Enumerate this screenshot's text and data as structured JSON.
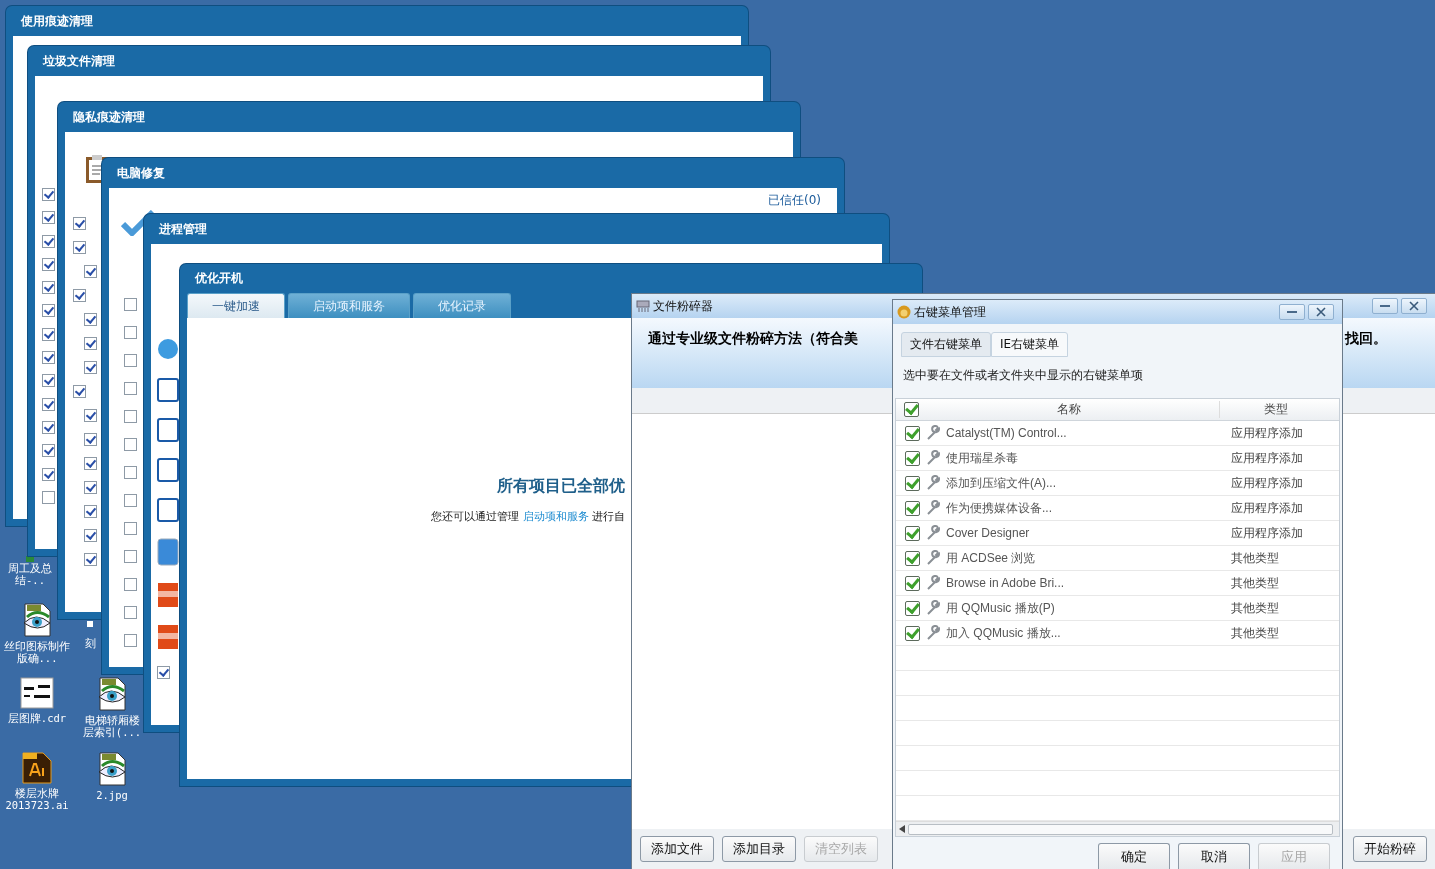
{
  "desktop_icons": [
    {
      "kind": "doc",
      "label": "周工及总结-.."
    },
    {
      "kind": "jpg",
      "label": "丝印图标制作版确..."
    },
    {
      "kind": "partial",
      "label": "刻"
    },
    {
      "kind": "cdr",
      "label": "层图牌.cdr"
    },
    {
      "kind": "jpg",
      "label": "电梯轿厢楼层索引(..."
    },
    {
      "kind": "ai",
      "label": "楼层水牌2013723.ai"
    },
    {
      "kind": "jpg",
      "label": "2.jpg"
    }
  ],
  "usage_cleanup": {
    "title": "使用痕迹清理"
  },
  "junk_cleanup": {
    "title": "垃圾文件清理",
    "items": [
      {
        "checked": true
      },
      {
        "checked": true
      },
      {
        "checked": true
      },
      {
        "checked": true
      },
      {
        "checked": true
      },
      {
        "checked": true
      },
      {
        "checked": true
      },
      {
        "checked": true
      },
      {
        "checked": true
      },
      {
        "checked": true
      },
      {
        "checked": true
      },
      {
        "checked": true
      },
      {
        "checked": true
      },
      {
        "checked": false
      }
    ]
  },
  "privacy_cleanup": {
    "title": "隐私痕迹清理",
    "groups": [
      {
        "checked": true
      },
      {
        "checked": true,
        "children": [
          {
            "checked": true
          }
        ]
      },
      {
        "checked": true,
        "children": [
          {
            "checked": true
          },
          {
            "checked": true
          },
          {
            "checked": true
          }
        ]
      },
      {
        "checked": true,
        "children": [
          {
            "checked": true
          },
          {
            "checked": true
          },
          {
            "checked": true
          },
          {
            "checked": true
          },
          {
            "checked": true
          },
          {
            "checked": true
          },
          {
            "checked": true
          }
        ]
      }
    ]
  },
  "pc_repair": {
    "title": "电脑修复",
    "trusted_link": "已信任(0)",
    "items": [
      {
        "checked": false
      },
      {
        "checked": false
      },
      {
        "checked": false
      },
      {
        "checked": false
      },
      {
        "checked": false
      },
      {
        "checked": false
      },
      {
        "checked": false
      },
      {
        "checked": false
      },
      {
        "checked": false
      },
      {
        "checked": false
      },
      {
        "checked": false
      },
      {
        "checked": false
      },
      {
        "checked": false
      }
    ]
  },
  "process_manager": {
    "title": "进程管理",
    "items": [
      {
        "checked": true
      }
    ]
  },
  "startup_optimizer": {
    "title": "优化开机",
    "tabs": [
      {
        "label": "一键加速",
        "selected": true
      },
      {
        "label": "启动项和服务",
        "selected": false
      },
      {
        "label": "优化记录",
        "selected": false
      }
    ],
    "heading": "所有项目已全部优",
    "hint_before": "您还可以通过管理",
    "hint_link": "启动项和服务",
    "hint_after": "进行自"
  },
  "file_shredder": {
    "title": "文件粉碎器",
    "intro_left": "通过专业级文件粉碎方法（符合美",
    "intro_right": "找回。",
    "buttons": [
      {
        "label": "添加文件",
        "disabled": false
      },
      {
        "label": "添加目录",
        "disabled": false
      },
      {
        "label": "清空列表",
        "disabled": true
      }
    ],
    "start_button": {
      "label": "开始粉碎",
      "disabled": false
    }
  },
  "context_menu_manager": {
    "title": "右键菜单管理",
    "tabs": [
      {
        "label": "文件右键菜单",
        "selected": true
      },
      {
        "label": "IE右键菜单",
        "selected": false
      }
    ],
    "description": "选中要在文件或者文件夹中显示的右键菜单项",
    "columns": [
      "名称",
      "类型"
    ],
    "all_checked": true,
    "rows": [
      {
        "name": "Catalyst(TM) Control...",
        "type": "应用程序添加",
        "checked": true
      },
      {
        "name": "使用瑞星杀毒",
        "type": "应用程序添加",
        "checked": true
      },
      {
        "name": "添加到压缩文件(A)...",
        "type": "应用程序添加",
        "checked": true
      },
      {
        "name": "作为便携媒体设备...",
        "type": "应用程序添加",
        "checked": true
      },
      {
        "name": "Cover Designer",
        "type": "应用程序添加",
        "checked": true
      },
      {
        "name": "用 ACDSee 浏览",
        "type": "其他类型",
        "checked": true
      },
      {
        "name": "Browse in Adobe Bri...",
        "type": "其他类型",
        "checked": true
      },
      {
        "name": "用 QQMusic 播放(P)",
        "type": "其他类型",
        "checked": true
      },
      {
        "name": "加入 QQMusic 播放...",
        "type": "其他类型",
        "checked": true
      }
    ],
    "buttons": [
      {
        "label": "确定",
        "disabled": false
      },
      {
        "label": "取消",
        "disabled": false
      },
      {
        "label": "应用",
        "disabled": true
      }
    ]
  }
}
